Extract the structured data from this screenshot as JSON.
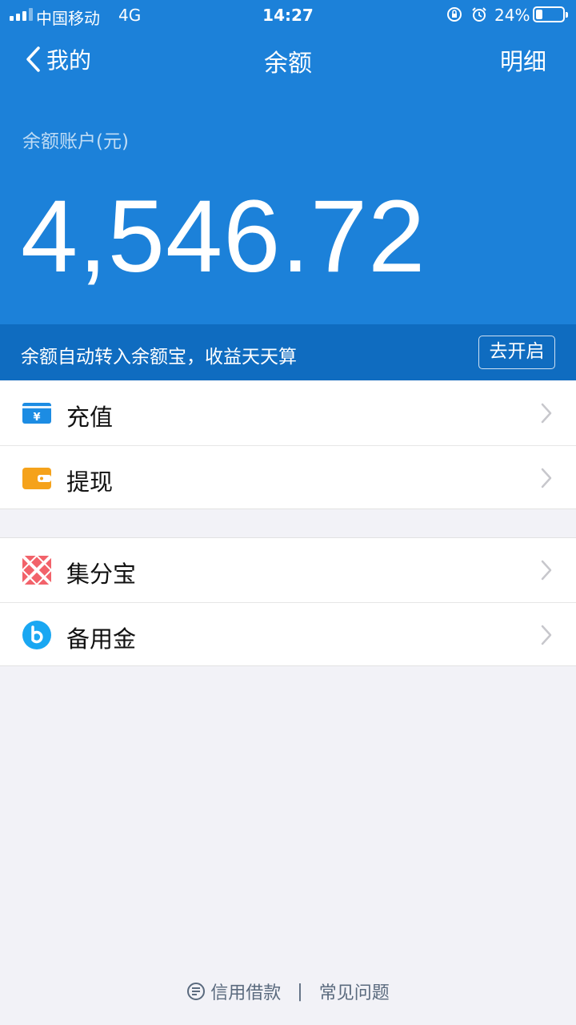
{
  "status_bar": {
    "carrier": "中国移动",
    "network": "4G",
    "time": "14:27",
    "battery": "24%"
  },
  "nav": {
    "back_label": "我的",
    "title": "余额",
    "detail_label": "明细"
  },
  "account": {
    "label": "余额账户(元)",
    "balance": "4,546.72"
  },
  "promo": {
    "text": "余额自动转入余额宝，收益天天算",
    "button": "去开启"
  },
  "group1": [
    {
      "label": "充值",
      "icon": "recharge-card-icon",
      "color": "#1c8ce3"
    },
    {
      "label": "提现",
      "icon": "wallet-icon",
      "color": "#f5a21b"
    }
  ],
  "group2": [
    {
      "label": "集分宝",
      "icon": "jifenbao-icon",
      "color": "#f2626a"
    },
    {
      "label": "备用金",
      "icon": "beiyongjin-icon",
      "color": "#1aa7f2"
    }
  ],
  "footer": {
    "credit_loan": "信用借款",
    "separator": "|",
    "faq": "常见问题"
  },
  "colors": {
    "header": "#1c81d9",
    "promo_bar": "#0f6cc0",
    "background": "#f2f2f7"
  }
}
